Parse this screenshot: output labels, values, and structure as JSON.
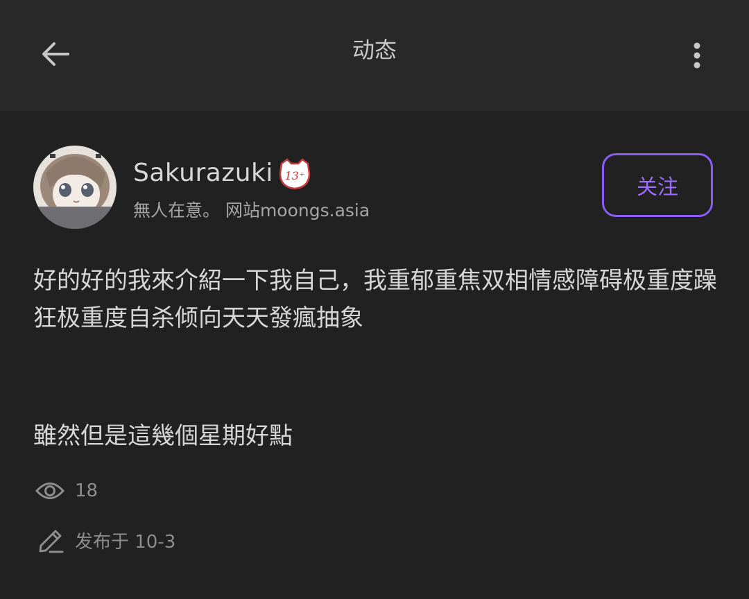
{
  "header": {
    "title": "动态",
    "back_icon": "arrow-left-icon",
    "more_icon": "more-vertical-icon"
  },
  "author": {
    "name": "Sakurazuki",
    "badge_text": "13⁺",
    "bio": "無人在意。 网站moongs.asia",
    "avatar_icon": "avatar-anime-girl"
  },
  "follow_button": {
    "label": "关注",
    "color": "#8b5cf6"
  },
  "post": {
    "paragraph1": "好的好的我來介紹一下我自己，我重郁重焦双相情感障碍极重度躁狂极重度自杀倾向天天發瘋抽象",
    "paragraph2": "雖然但是這幾個星期好點"
  },
  "meta": {
    "views_icon": "eye-icon",
    "views": "18",
    "date_icon": "pencil-icon",
    "published": "发布于 10-3"
  },
  "colors": {
    "background": "#212121",
    "topbar": "#282828",
    "accent": "#8b5cf6"
  }
}
